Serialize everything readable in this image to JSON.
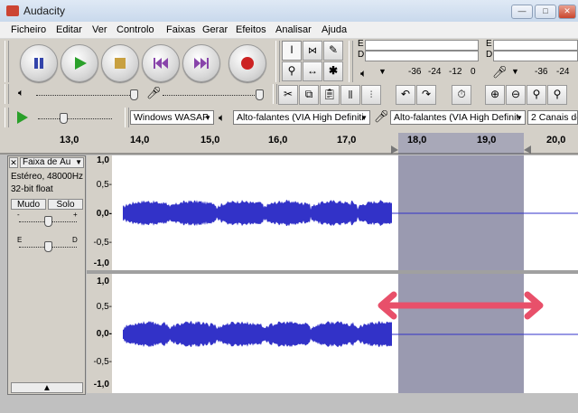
{
  "window": {
    "title": "Audacity",
    "controls": [
      "—",
      "□",
      "✕"
    ]
  },
  "menu": [
    "Ficheiro",
    "Editar",
    "Ver",
    "Controlo",
    "Faixas",
    "Gerar",
    "Efeitos",
    "Analisar",
    "Ajuda"
  ],
  "meters": {
    "play_label": "E",
    "play_label2": "D",
    "rec_label": "E",
    "rec_label2": "D",
    "scale": [
      "-36",
      "-24",
      "-12",
      "0"
    ],
    "scale2": [
      "-36",
      "-24"
    ]
  },
  "devices": {
    "host": "Windows WASAP",
    "output": "Alto-falantes (VIA High Definiti",
    "input": "Alto-falantes (VIA High Definit",
    "channels": "2 Canais de G"
  },
  "ruler": {
    "ticks": [
      "13,0",
      "14,0",
      "15,0",
      "16,0",
      "17,0",
      "18,0",
      "19,0",
      "20,0"
    ]
  },
  "track": {
    "name": "Faixa de Áu",
    "close": "✕",
    "info1": "Estéreo, 48000Hz",
    "info2": "32-bit float",
    "mute": "Mudo",
    "solo": "Solo",
    "gain_minus": "-",
    "gain_plus": "+",
    "pan_left": "E",
    "pan_right": "D",
    "collapse": "▲"
  },
  "vscale1": [
    "1,0",
    "0,5-",
    "0,0-",
    "-0,5-",
    "-1,0"
  ],
  "vscale2": [
    "1,0",
    "0,5-",
    "0,0-",
    "-0,5-",
    "-1,0"
  ],
  "colors": {
    "wave": "#3232c8",
    "selection": "#9a9ab0",
    "arrow": "#e8506a"
  }
}
